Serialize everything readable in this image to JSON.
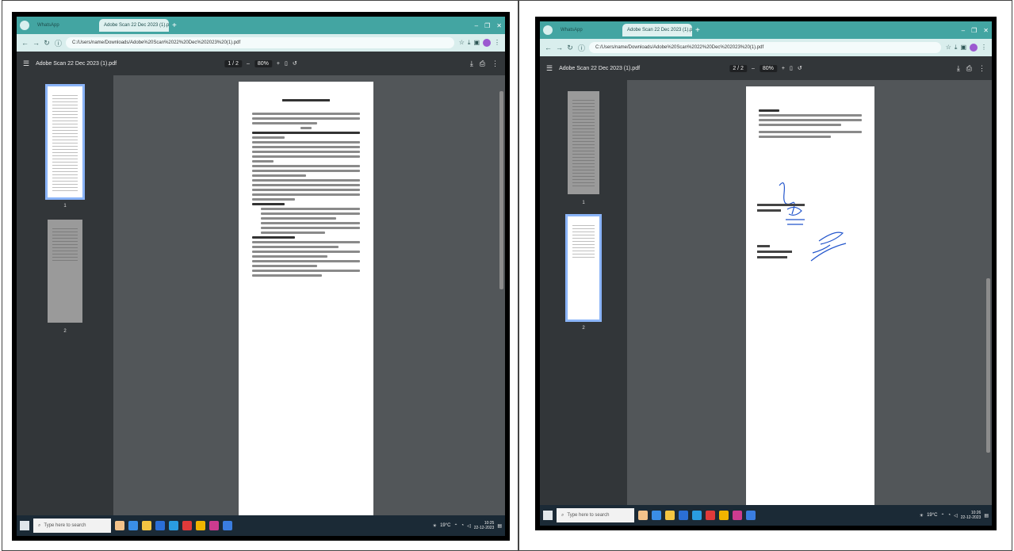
{
  "screens": [
    {
      "id": "left",
      "tabs": {
        "inactive_label": "WhatsApp",
        "active_label": "Adobe Scan 22 Dec 2023 (1).pdf",
        "window_controls": [
          "–",
          "❐",
          "✕"
        ]
      },
      "address": {
        "url": "C:/Users/name/Downloads/Adobe%20Scan%2022%20Dec%202023%20(1).pdf"
      },
      "pdf_toolbar": {
        "file_name": "Adobe Scan 22 Dec 2023 (1).pdf",
        "page_indicator": "1 / 2",
        "zoom": "80%"
      },
      "thumbnails": [
        {
          "num": "1",
          "selected": true
        },
        {
          "num": "2",
          "selected": false
        }
      ],
      "taskbar": {
        "search_placeholder": "Type here to search",
        "weather": "19°C",
        "time": "10:25",
        "date": "22-12-2023"
      }
    },
    {
      "id": "right",
      "tabs": {
        "inactive_label": "WhatsApp",
        "active_label": "Adobe Scan 22 Dec 2023 (1).pdf",
        "window_controls": [
          "–",
          "❐",
          "✕"
        ]
      },
      "address": {
        "url": "C:/Users/name/Downloads/Adobe%20Scan%2022%20Dec%202023%20(1).pdf"
      },
      "pdf_toolbar": {
        "file_name": "Adobe Scan 22 Dec 2023 (1).pdf",
        "page_indicator": "2 / 2",
        "zoom": "80%"
      },
      "thumbnails": [
        {
          "num": "1",
          "selected": false
        },
        {
          "num": "2",
          "selected": true
        }
      ],
      "taskbar": {
        "search_placeholder": "Type here to search",
        "weather": "19°C",
        "time": "10:26",
        "date": "22-12-2023"
      }
    }
  ],
  "colors": {
    "tabstrip": "#43a5a2",
    "pdf_toolbar": "#323639",
    "doc_background": "#525659",
    "taskbar": "#1b2a36",
    "selection": "#8ab4f8"
  },
  "icons": [
    "back-icon",
    "forward-icon",
    "reload-icon",
    "info-icon",
    "star-icon",
    "download-icon",
    "extensions-icon",
    "profile-icon",
    "menu-icon",
    "fit-page-icon",
    "rotate-icon",
    "print-icon",
    "more-icon",
    "windows-start-icon",
    "search-icon"
  ]
}
